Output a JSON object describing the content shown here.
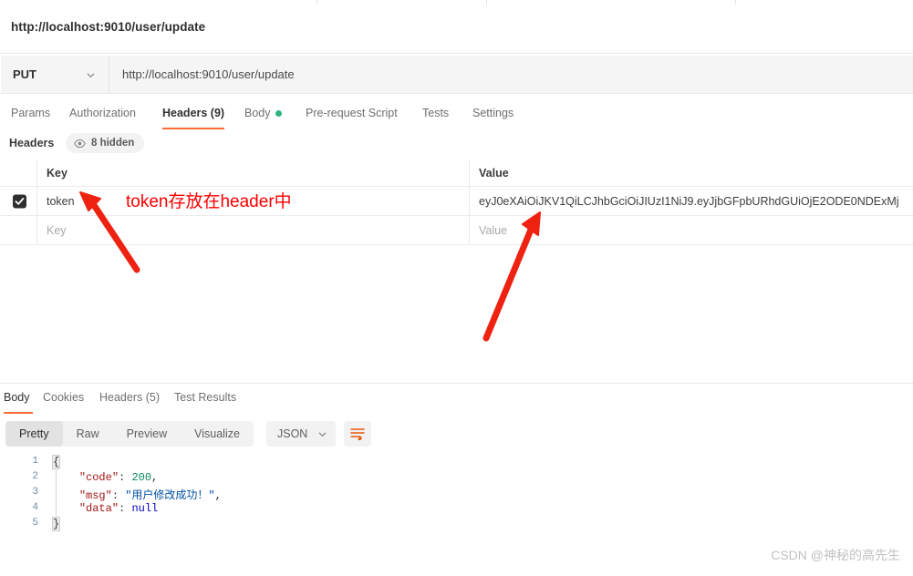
{
  "request": {
    "title": "http://localhost:9010/user/update",
    "method": "PUT",
    "url": "http://localhost:9010/user/update",
    "tabs": [
      {
        "label": "Params",
        "active": false
      },
      {
        "label": "Authorization",
        "active": false
      },
      {
        "label": "Headers (9)",
        "active": true
      },
      {
        "label": "Body",
        "active": false
      },
      {
        "label": "Pre-request Script",
        "active": false
      },
      {
        "label": "Tests",
        "active": false
      },
      {
        "label": "Settings",
        "active": false
      }
    ]
  },
  "headers_section": {
    "label": "Headers",
    "hidden_pill": "8 hidden",
    "columns": {
      "key": "Key",
      "value": "Value"
    },
    "rows": [
      {
        "checked": true,
        "key": "token",
        "value": "eyJ0eXAiOiJKV1QiLCJhbGciOiJIUzI1NiJ9.eyJjbGFpbURhdGUiOjE2ODE0NDExMj"
      }
    ],
    "empty_row": {
      "key_placeholder": "Key",
      "value_placeholder": "Value"
    }
  },
  "annotation": {
    "text": "token存放在header中",
    "color": "#ff0000"
  },
  "response": {
    "tabs": [
      {
        "label": "Body",
        "active": true
      },
      {
        "label": "Cookies",
        "active": false
      },
      {
        "label": "Headers (5)",
        "active": false
      },
      {
        "label": "Test Results",
        "active": false
      }
    ],
    "format_buttons": [
      {
        "label": "Pretty",
        "active": true
      },
      {
        "label": "Raw",
        "active": false
      },
      {
        "label": "Preview",
        "active": false
      },
      {
        "label": "Visualize",
        "active": false
      }
    ],
    "language": "JSON",
    "body_lines": [
      {
        "n": "1",
        "segments": [
          {
            "t": "{",
            "c": "brace"
          }
        ]
      },
      {
        "n": "2",
        "segments": [
          {
            "t": "    ",
            "c": "pun"
          },
          {
            "t": "\"code\"",
            "c": "key"
          },
          {
            "t": ": ",
            "c": "pun"
          },
          {
            "t": "200",
            "c": "num"
          },
          {
            "t": ",",
            "c": "pun"
          }
        ]
      },
      {
        "n": "3",
        "segments": [
          {
            "t": "    ",
            "c": "pun"
          },
          {
            "t": "\"msg\"",
            "c": "key"
          },
          {
            "t": ": ",
            "c": "pun"
          },
          {
            "t": "\"用户修改成功！\"",
            "c": "str"
          },
          {
            "t": ",",
            "c": "pun"
          }
        ]
      },
      {
        "n": "4",
        "segments": [
          {
            "t": "    ",
            "c": "pun"
          },
          {
            "t": "\"data\"",
            "c": "key"
          },
          {
            "t": ": ",
            "c": "pun"
          },
          {
            "t": "null",
            "c": "null"
          }
        ]
      },
      {
        "n": "5",
        "segments": [
          {
            "t": "}",
            "c": "brace"
          }
        ]
      }
    ]
  },
  "watermark": "CSDN @神秘的高先生",
  "colors": {
    "accent": "#ff6c37",
    "body_dot": "#2eb67d",
    "annotation": "#ff0000"
  }
}
